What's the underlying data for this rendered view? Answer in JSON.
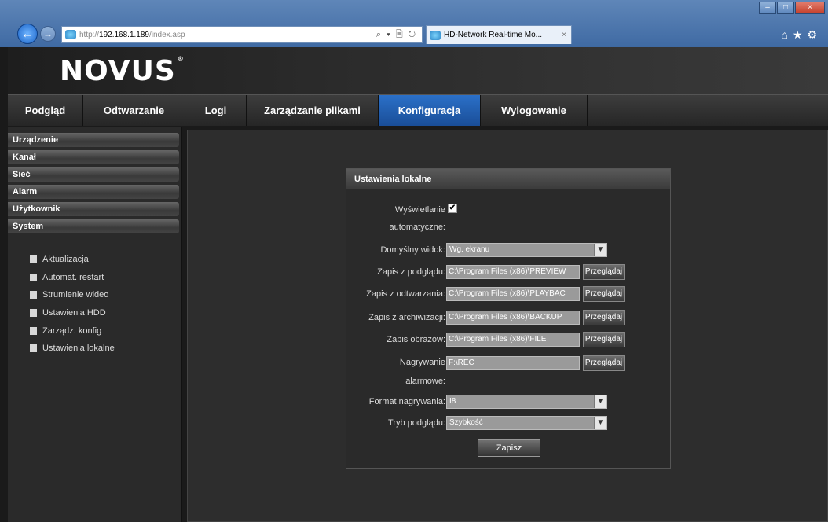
{
  "browser": {
    "address": "http://192.168.1.189/index.asp",
    "address_prefix": "http://",
    "address_host": "192.168.1.189",
    "address_path": "/index.asp",
    "address_tools": "⌕ ▾ 🖹 ↻",
    "tab_title": "HD-Network Real-time Mo...",
    "tab_close": "×",
    "icons": "⌂★⚙"
  },
  "app": {
    "logo": "NOVUS",
    "logo_mark": "®"
  },
  "topnav": {
    "items": [
      {
        "label": "Podgląd"
      },
      {
        "label": "Odtwarzanie"
      },
      {
        "label": "Logi"
      },
      {
        "label": "Zarządzanie plikami"
      },
      {
        "label": "Konfiguracja"
      },
      {
        "label": "Wylogowanie"
      }
    ]
  },
  "sidebar": {
    "sections": [
      {
        "label": "Urządzenie"
      },
      {
        "label": "Kanał"
      },
      {
        "label": "Sieć"
      },
      {
        "label": "Alarm"
      },
      {
        "label": "Użytkownik"
      },
      {
        "label": "System"
      }
    ],
    "items": [
      {
        "label": "Aktualizacja"
      },
      {
        "label": "Automat. restart"
      },
      {
        "label": "Strumienie wideo"
      },
      {
        "label": "Ustawienia HDD"
      },
      {
        "label": "Zarządz. konfig"
      },
      {
        "label": "Ustawienia lokalne"
      }
    ]
  },
  "dialog": {
    "title": "Ustawienia lokalne",
    "fields": {
      "auto_display": {
        "label": "Wyświetlanie",
        "label2": "automatyczne:",
        "checked": "✔"
      },
      "default_view": {
        "label": "Domyślny widok:",
        "value": "Wg. ekranu"
      },
      "preview_save": {
        "label": "Zapis z podglądu:",
        "value": "C:\\Program Files (x86)\\PREVIEW",
        "button": "Przeglądaj"
      },
      "playback_save": {
        "label": "Zapis z odtwarzania:",
        "value": "C:\\Program Files (x86)\\PLAYBAC",
        "button": "Przeglądaj"
      },
      "archive_save": {
        "label": "Zapis z archiwizacji:",
        "value": "C:\\Program Files (x86)\\BACKUP",
        "button": "Przeglądaj"
      },
      "image_save": {
        "label": "Zapis obrazów:",
        "value": "C:\\Program Files (x86)\\FILE",
        "button": "Przeglądaj"
      },
      "alarm_record": {
        "label": "Nagrywanie",
        "label2": "alarmowe:",
        "value": "F:\\REC",
        "button": "Przeglądaj"
      },
      "record_format": {
        "label": "Format nagrywania:",
        "value": "I8"
      },
      "preview_mode": {
        "label": "Tryb podglądu:",
        "value": "Szybkość"
      }
    },
    "save_label": "Zapisz"
  },
  "colors": {
    "active_tab": "#1f5fb3",
    "background": "#2d2d2d"
  }
}
